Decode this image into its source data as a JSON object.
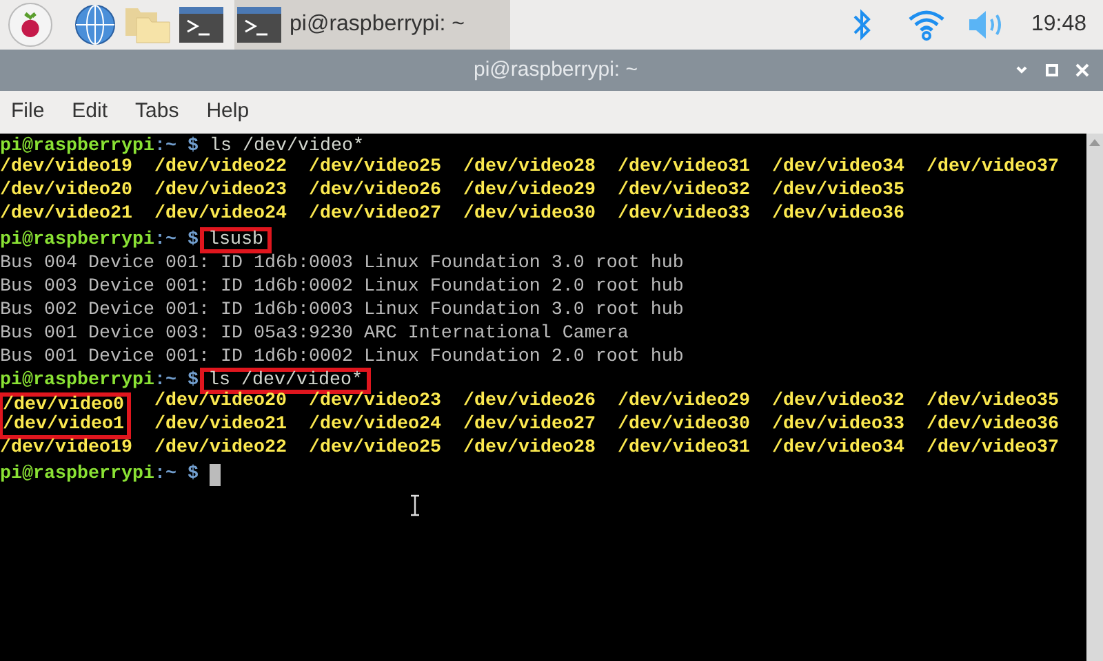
{
  "taskbar": {
    "task": {
      "title": "pi@raspberrypi: ~",
      "selected": true
    },
    "clock": "19:48"
  },
  "window": {
    "title": "pi@raspberrypi: ~"
  },
  "menu": [
    "File",
    "Edit",
    "Tabs",
    "Help"
  ],
  "terminal": {
    "lines": [
      {
        "kind": "prompt",
        "user": "pi@raspberrypi",
        "path": ":~",
        "symbol": "$",
        "command": "ls /dev/video*",
        "marked": false
      },
      {
        "kind": "listing",
        "rows": [
          [
            {
              "text": "/dev/video19",
              "marked": false
            },
            {
              "text": "/dev/video22",
              "marked": false
            },
            {
              "text": "/dev/video25",
              "marked": false
            },
            {
              "text": "/dev/video28",
              "marked": false
            },
            {
              "text": "/dev/video31",
              "marked": false
            },
            {
              "text": "/dev/video34",
              "marked": false
            },
            {
              "text": "/dev/video37",
              "marked": false
            }
          ],
          [
            {
              "text": "/dev/video20",
              "marked": false
            },
            {
              "text": "/dev/video23",
              "marked": false
            },
            {
              "text": "/dev/video26",
              "marked": false
            },
            {
              "text": "/dev/video29",
              "marked": false
            },
            {
              "text": "/dev/video32",
              "marked": false
            },
            {
              "text": "/dev/video35",
              "marked": false
            }
          ],
          [
            {
              "text": "/dev/video21",
              "marked": false
            },
            {
              "text": "/dev/video24",
              "marked": false
            },
            {
              "text": "/dev/video27",
              "marked": false
            },
            {
              "text": "/dev/video30",
              "marked": false
            },
            {
              "text": "/dev/video33",
              "marked": false
            },
            {
              "text": "/dev/video36",
              "marked": false
            }
          ]
        ]
      },
      {
        "kind": "prompt",
        "user": "pi@raspberrypi",
        "path": ":~",
        "symbol": "$",
        "command": "lsusb",
        "marked": true
      },
      {
        "kind": "output",
        "text": "Bus 004 Device 001: ID 1d6b:0003 Linux Foundation 3.0 root hub"
      },
      {
        "kind": "output",
        "text": "Bus 003 Device 001: ID 1d6b:0002 Linux Foundation 2.0 root hub"
      },
      {
        "kind": "output",
        "text": "Bus 002 Device 001: ID 1d6b:0003 Linux Foundation 3.0 root hub"
      },
      {
        "kind": "output",
        "text": "Bus 001 Device 003: ID 05a3:9230 ARC International Camera"
      },
      {
        "kind": "output",
        "text": "Bus 001 Device 001: ID 1d6b:0002 Linux Foundation 2.0 root hub"
      },
      {
        "kind": "prompt",
        "user": "pi@raspberrypi",
        "path": ":~",
        "symbol": "$",
        "command": "ls /dev/video*",
        "marked": true
      },
      {
        "kind": "listing",
        "rows": [
          [
            {
              "text": "/dev/video0",
              "marked": true
            },
            {
              "text": "/dev/video20",
              "marked": false
            },
            {
              "text": "/dev/video23",
              "marked": false
            },
            {
              "text": "/dev/video26",
              "marked": false
            },
            {
              "text": "/dev/video29",
              "marked": false
            },
            {
              "text": "/dev/video32",
              "marked": false
            },
            {
              "text": "/dev/video35",
              "marked": false
            }
          ],
          [
            {
              "text": "/dev/video1",
              "marked": true
            },
            {
              "text": "/dev/video21",
              "marked": false
            },
            {
              "text": "/dev/video24",
              "marked": false
            },
            {
              "text": "/dev/video27",
              "marked": false
            },
            {
              "text": "/dev/video30",
              "marked": false
            },
            {
              "text": "/dev/video33",
              "marked": false
            },
            {
              "text": "/dev/video36",
              "marked": false
            }
          ],
          [
            {
              "text": "/dev/video19",
              "marked": false
            },
            {
              "text": "/dev/video22",
              "marked": false
            },
            {
              "text": "/dev/video25",
              "marked": false
            },
            {
              "text": "/dev/video28",
              "marked": false
            },
            {
              "text": "/dev/video31",
              "marked": false
            },
            {
              "text": "/dev/video34",
              "marked": false
            },
            {
              "text": "/dev/video37",
              "marked": false
            }
          ]
        ]
      },
      {
        "kind": "prompt",
        "user": "pi@raspberrypi",
        "path": ":~",
        "symbol": "$",
        "cursor": true
      }
    ]
  }
}
